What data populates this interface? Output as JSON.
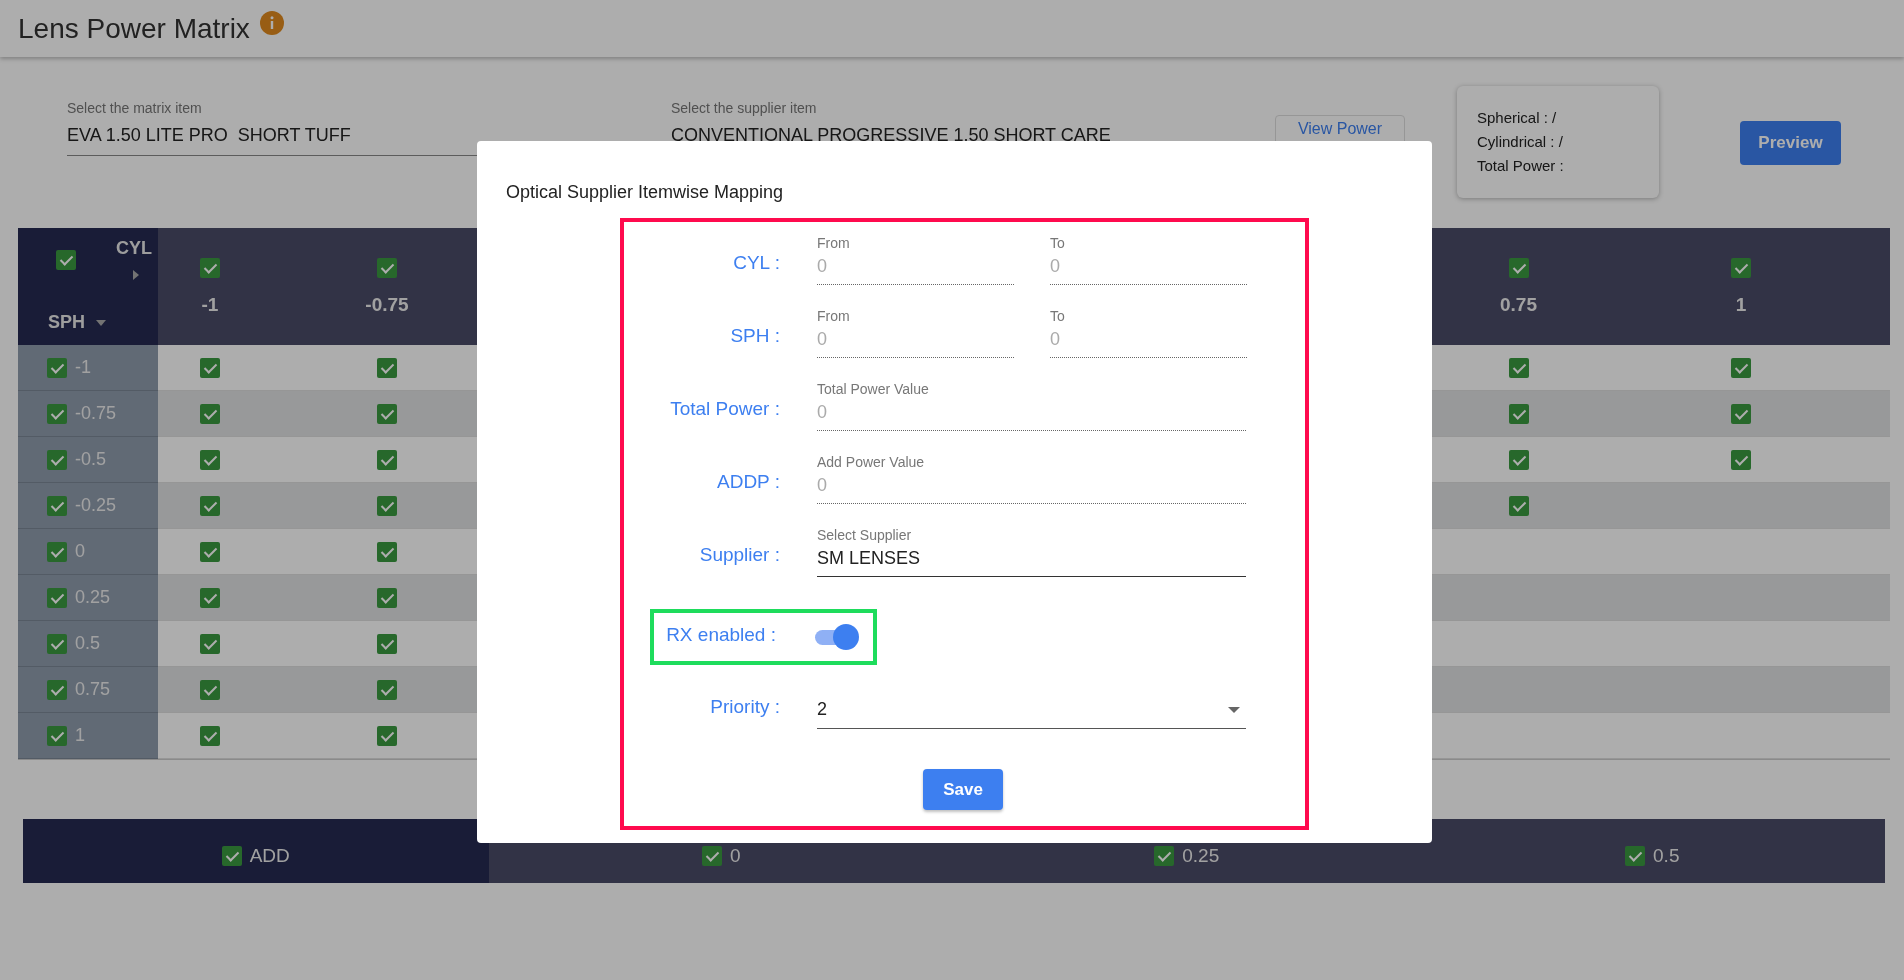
{
  "page_title": "Lens Power Matrix",
  "matrix_select": {
    "label": "Select the matrix item",
    "value": "EVA 1.50 LITE PRO  SHORT TUFF"
  },
  "supplier_select": {
    "label": "Select the supplier item",
    "value": "CONVENTIONAL PROGRESSIVE 1.50 SHORT CARE"
  },
  "view_power_button": "View Power",
  "power_info": [
    "Spherical : /",
    "Cylindrical : /",
    "Total Power :"
  ],
  "preview_button": "Preview",
  "matrix": {
    "corner": {
      "checked": true,
      "column_axis": "CYL",
      "row_axis": "SPH"
    },
    "columns": [
      {
        "label": "-1",
        "checked": true
      },
      {
        "label": "-0.75",
        "checked": true
      },
      {
        "label": "0.75",
        "checked": true
      },
      {
        "label": "1",
        "checked": true
      }
    ],
    "rows": [
      {
        "label": "-1",
        "checked": true,
        "cells": [
          {
            "checked": true
          },
          {
            "checked": true
          },
          {
            "checked": true
          },
          {
            "checked": true
          }
        ]
      },
      {
        "label": "-0.75",
        "checked": true,
        "cells": [
          {
            "checked": true
          },
          {
            "checked": true
          },
          {
            "checked": true
          },
          {
            "checked": true
          }
        ]
      },
      {
        "label": "-0.5",
        "checked": true,
        "cells": [
          {
            "checked": true
          },
          {
            "checked": true
          },
          {
            "checked": true
          },
          {
            "checked": true
          }
        ]
      },
      {
        "label": "-0.25",
        "checked": true,
        "cells": [
          {
            "checked": true
          },
          {
            "checked": true
          },
          {
            "checked": true
          },
          {
            "checked": false
          }
        ]
      },
      {
        "label": "0",
        "checked": true,
        "cells": [
          {
            "checked": true
          },
          {
            "checked": true
          },
          {
            "checked": false
          },
          {
            "checked": false
          }
        ]
      },
      {
        "label": "0.25",
        "checked": true,
        "cells": [
          {
            "checked": true
          },
          {
            "checked": true
          },
          {
            "checked": false
          },
          {
            "checked": false
          }
        ]
      },
      {
        "label": "0.5",
        "checked": true,
        "cells": [
          {
            "checked": true
          },
          {
            "checked": true
          },
          {
            "checked": false
          },
          {
            "checked": false
          }
        ]
      },
      {
        "label": "0.75",
        "checked": true,
        "cells": [
          {
            "checked": true
          },
          {
            "checked": true
          },
          {
            "checked": false
          },
          {
            "checked": false
          }
        ]
      },
      {
        "label": "1",
        "checked": true,
        "cells": [
          {
            "checked": true
          },
          {
            "checked": true
          },
          {
            "checked": false
          },
          {
            "checked": false
          }
        ]
      }
    ]
  },
  "add_bar": [
    {
      "kind": "header",
      "label": "ADD",
      "checked": true
    },
    {
      "kind": "value",
      "label": "0",
      "checked": true
    },
    {
      "kind": "value",
      "label": "0.25",
      "checked": true
    },
    {
      "kind": "value",
      "label": "0.5",
      "checked": true
    }
  ],
  "dialog": {
    "title": "Optical Supplier Itemwise Mapping",
    "fields": [
      {
        "kind": "inputs",
        "label": "CYL :",
        "inputs": [
          {
            "label": "From",
            "value": "0",
            "disabled": true
          },
          {
            "label": "To",
            "value": "0",
            "disabled": true
          }
        ]
      },
      {
        "kind": "inputs",
        "label": "SPH :",
        "inputs": [
          {
            "label": "From",
            "value": "0",
            "disabled": true
          },
          {
            "label": "To",
            "value": "0",
            "disabled": true
          }
        ]
      },
      {
        "kind": "inputs",
        "label": "Total Power :",
        "inputs": [
          {
            "label": "Total Power Value",
            "value": "0",
            "disabled": true
          }
        ]
      },
      {
        "kind": "inputs",
        "label": "ADDP :",
        "inputs": [
          {
            "label": "Add Power Value",
            "value": "0",
            "disabled": true
          }
        ]
      },
      {
        "kind": "inputs",
        "label": "Supplier :",
        "inputs": [
          {
            "label": "Select Supplier",
            "value": "SM LENSES",
            "disabled": false
          }
        ]
      },
      {
        "kind": "toggle",
        "label": "RX enabled :",
        "on": true
      },
      {
        "kind": "dropdown",
        "label": "Priority :",
        "value": "2"
      }
    ],
    "save_button": "Save"
  }
}
